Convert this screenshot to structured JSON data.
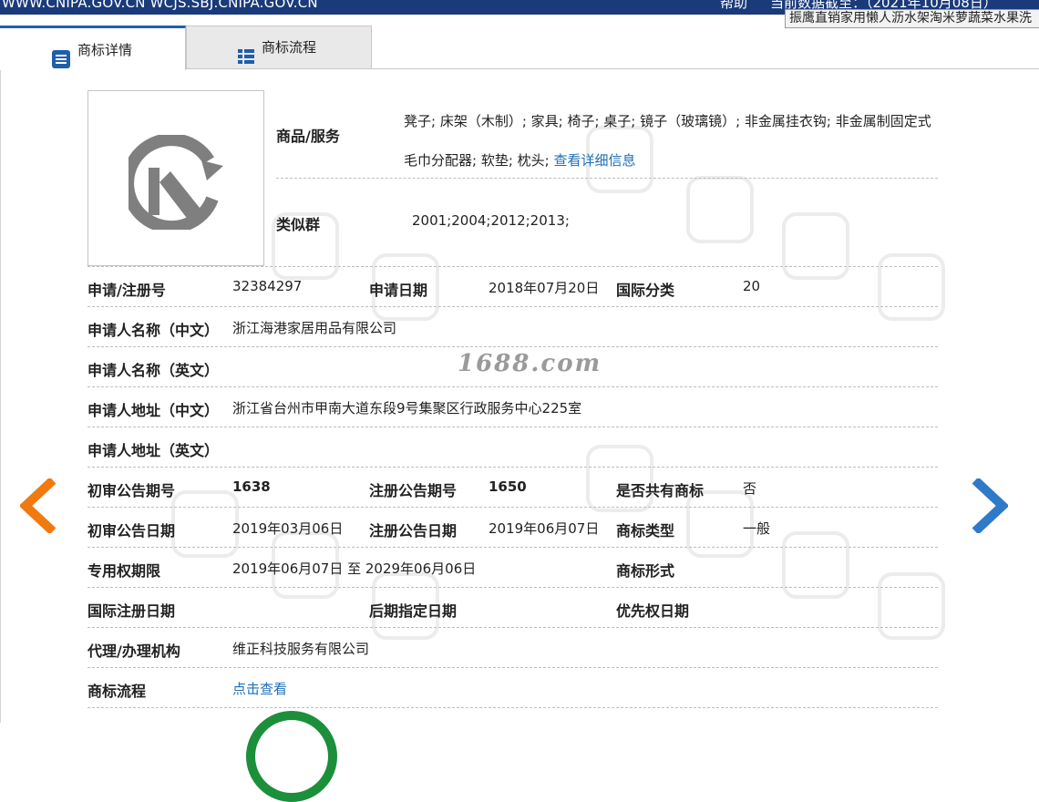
{
  "topbar": {
    "url_text": "WWW.CNIPA.GOV.CN WCJS.SBJ.CNIPA.GOV.CN",
    "help": "帮助",
    "date_text": "当前数据截至：（2021年10月08日）"
  },
  "tooltip": "振鹰直销家用懒人沥水架淘米萝蔬菜水果洗",
  "tabs": [
    {
      "label": "商标详情",
      "active": true
    },
    {
      "label": "商标流程",
      "active": false
    }
  ],
  "watermark_site": "1688.com",
  "goods_services": {
    "label": "商品/服务",
    "text": "凳子; 床架（木制）; 家具; 椅子; 桌子; 镜子（玻璃镜）; 非金属挂衣钩; 非金属制固定式毛巾分配器; 软垫; 枕头;",
    "link": "查看详细信息"
  },
  "similar_group": {
    "label": "类似群",
    "value": "2001;2004;2012;2013;"
  },
  "details": {
    "reg_no_label": "申请/注册号",
    "reg_no": "32384297",
    "app_date_label": "申请日期",
    "app_date": "2018年07月20日",
    "intl_class_label": "国际分类",
    "intl_class": "20",
    "applicant_cn_label": "申请人名称（中文）",
    "applicant_cn": "浙江海港家居用品有限公司",
    "applicant_en_label": "申请人名称（英文）",
    "applicant_en": "",
    "address_cn_label": "申请人地址（中文）",
    "address_cn": "浙江省台州市甲南大道东段9号集聚区行政服务中心225室",
    "address_en_label": "申请人地址（英文）",
    "address_en": "",
    "prelim_no_label": "初审公告期号",
    "prelim_no": "1638",
    "reg_pub_no_label": "注册公告期号",
    "reg_pub_no": "1650",
    "shared_label": "是否共有商标",
    "shared": "否",
    "prelim_date_label": "初审公告日期",
    "prelim_date": "2019年03月06日",
    "reg_pub_date_label": "注册公告日期",
    "reg_pub_date": "2019年06月07日",
    "type_label": "商标类型",
    "type": "一般",
    "term_label": "专用权期限",
    "term": "2019年06月07日 至 2029年06月06日",
    "form_label": "商标形式",
    "form": "",
    "intl_reg_date_label": "国际注册日期",
    "intl_reg_date": "",
    "later_date_label": "后期指定日期",
    "later_date": "",
    "priority_label": "优先权日期",
    "priority": "",
    "agent_label": "代理/办理机构",
    "agent": "维正科技服务有限公司",
    "process_label": "商标流程",
    "process_link": "点击查看"
  },
  "colors": {
    "accent": "#1f5faa",
    "link": "#1d6fb8",
    "prev_arrow": "#f07a10",
    "next_arrow": "#2e7ac8"
  }
}
